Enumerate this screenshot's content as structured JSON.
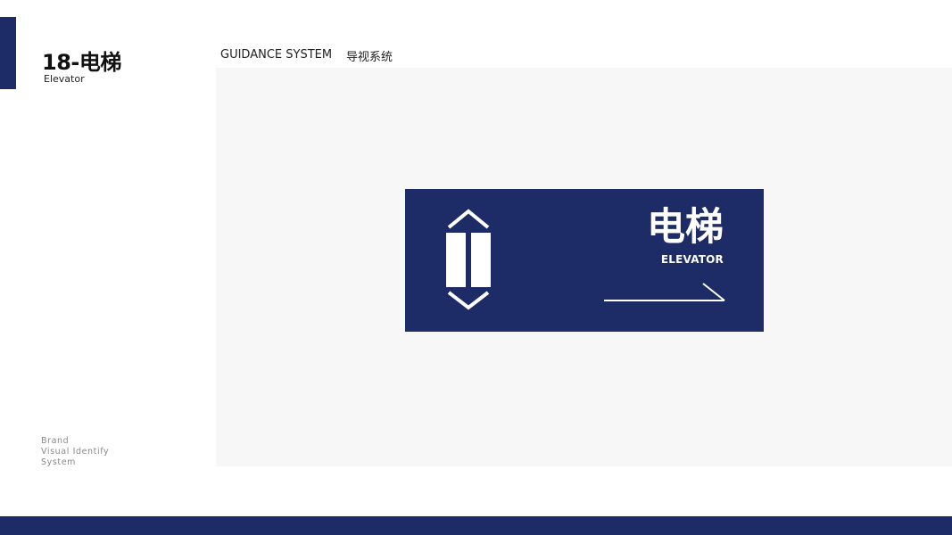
{
  "colors": {
    "brand_navy": "#1d2c66",
    "canvas_bg": "#f7f7f7",
    "sign_text": "#ffffff"
  },
  "page": {
    "number_title": "18-电梯",
    "subtitle": "Elevator"
  },
  "header": {
    "title_en": "GUIDANCE SYSTEM",
    "title_cn": "导视系统"
  },
  "sign": {
    "label_cn": "电梯",
    "label_en": "ELEVATOR",
    "icon": "elevator-up-down-icon",
    "arrow": "right-arrow-icon"
  },
  "brand_footer": {
    "lines": [
      "Brand",
      "Visual Identify",
      "System"
    ]
  }
}
